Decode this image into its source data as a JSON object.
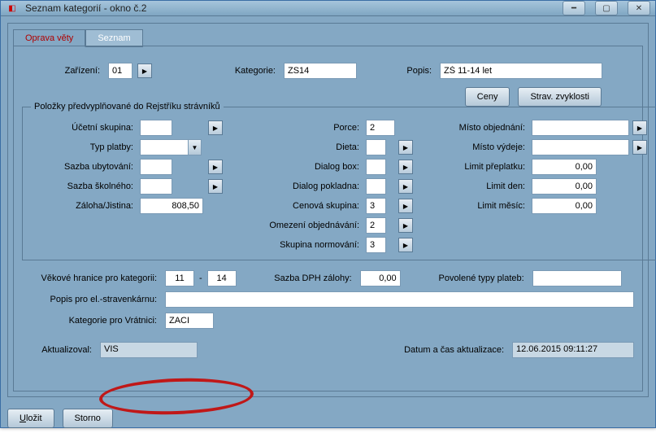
{
  "window": {
    "title": "Seznam kategorií - okno č.2"
  },
  "tabs": {
    "edit": "Oprava věty",
    "list": "Seznam"
  },
  "top": {
    "device_label": "Zařízení:",
    "device_value": "01",
    "category_label": "Kategorie:",
    "category_value": "ZS14",
    "desc_label": "Popis:",
    "desc_value": "ZŠ 11-14 let"
  },
  "buttons": {
    "prices": "Ceny",
    "habits": "Strav. zvyklosti",
    "save": "Uložit",
    "cancel": "Storno"
  },
  "group": {
    "legend": "Položky předvyplňované do Rejstříku strávníků",
    "left": {
      "ucetni_label": "Účetní skupina:",
      "ucetni_value": "",
      "typ_label": "Typ platby:",
      "typ_value": "",
      "sazba_ubyt_label": "Sazba ubytování:",
      "sazba_ubyt_value": "",
      "sazba_skol_label": "Sazba školného:",
      "sazba_skol_value": "",
      "zaloha_label": "Záloha/Jistina:",
      "zaloha_value": "808,50"
    },
    "mid": {
      "porce_label": "Porce:",
      "porce_value": "2",
      "dieta_label": "Dieta:",
      "dieta_value": "",
      "dialogbox_label": "Dialog box:",
      "dialogbox_value": "",
      "dialogpok_label": "Dialog pokladna:",
      "dialogpok_value": "",
      "cen_label": "Cenová skupina:",
      "cen_value": "3",
      "omez_label": "Omezení objednávání:",
      "omez_value": "2",
      "norm_label": "Skupina normování:",
      "norm_value": "3"
    },
    "right": {
      "misto_obj_label": "Místo objednání:",
      "misto_obj_value": "",
      "misto_vyd_label": "Místo výdeje:",
      "misto_vyd_value": "",
      "limit_prep_label": "Limit přeplatku:",
      "limit_prep_value": "0,00",
      "limit_den_label": "Limit den:",
      "limit_den_value": "0,00",
      "limit_mes_label": "Limit měsíc:",
      "limit_mes_value": "0,00"
    }
  },
  "lower": {
    "vek_label": "Věkové hranice pro kategorii:",
    "vek_from": "11",
    "vek_dash": "-",
    "vek_to": "14",
    "dph_label": "Sazba DPH zálohy:",
    "dph_value": "0,00",
    "povol_label": "Povolené typy plateb:",
    "povol_value": "",
    "popis_label": "Popis pro el.-stravenkárnu:",
    "popis_value": "",
    "kat_vrat_label": "Kategorie pro Vrátnici:",
    "kat_vrat_value": "ZACI"
  },
  "footer": {
    "akt_label": "Aktualizoval:",
    "akt_value": "VIS",
    "datum_label": "Datum a čas aktualizace:",
    "datum_value": "12.06.2015 09:11:27"
  }
}
